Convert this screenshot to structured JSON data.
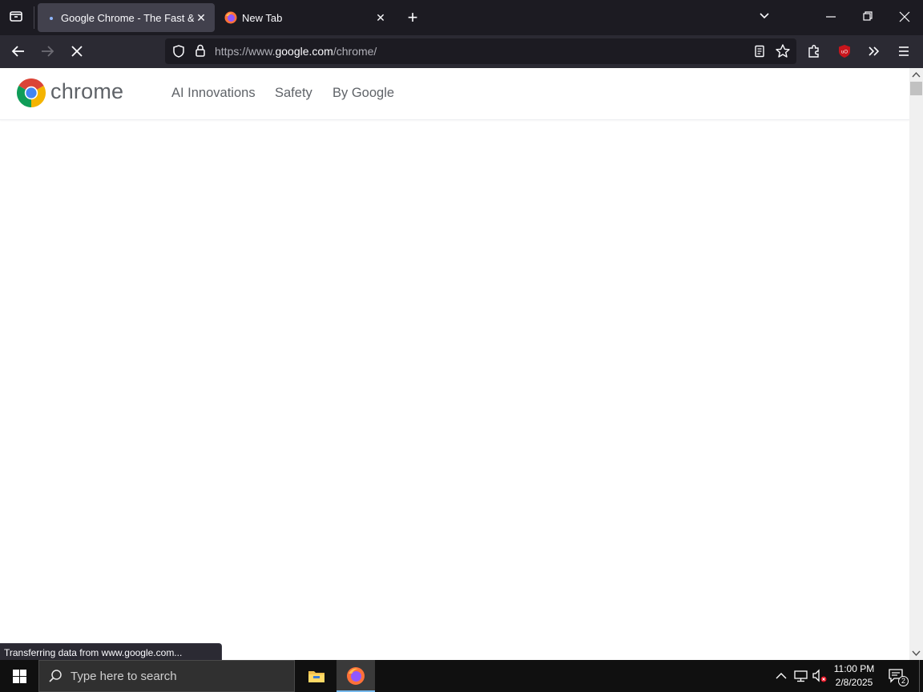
{
  "browser": {
    "tabs": [
      {
        "title": "Google Chrome - The Fast & Se",
        "active": true
      },
      {
        "title": "New Tab",
        "active": false
      }
    ],
    "url": {
      "prefix": "https://www.",
      "domain": "google.com",
      "path": "/chrome/"
    },
    "status_text": "Transferring data from www.google.com..."
  },
  "site": {
    "brand": "chrome",
    "nav": [
      "AI Innovations",
      "Safety",
      "By Google"
    ]
  },
  "taskbar": {
    "search_placeholder": "Type here to search",
    "time": "11:00 PM",
    "date": "2/8/2025",
    "notification_count": "2"
  },
  "colors": {
    "accent_ublock": "#c8151c",
    "chrome_red": "#db4437",
    "chrome_yellow": "#f4b400",
    "chrome_green": "#0f9d58",
    "chrome_blue": "#4285f4"
  }
}
